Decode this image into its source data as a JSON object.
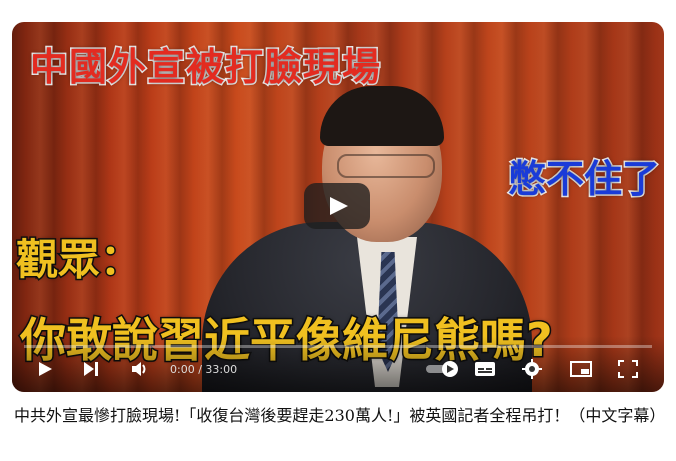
{
  "video": {
    "overlay": {
      "headline": "中國外宣被打臉現場",
      "cant_hold": "憋不住了",
      "audience": "觀眾：",
      "question": "你敢說習近平像維尼熊嗎?"
    },
    "time": "0:00 / 33:00"
  },
  "title": "中共外宣最慘打臉現場!「收復台灣後要趕走230萬人!」被英國記者全程吊打！（中文字幕）",
  "icons": {
    "play": "play-icon",
    "next": "next-icon",
    "volume": "volume-icon",
    "autoplay": "autoplay-toggle-icon",
    "subtitles": "subtitles-icon",
    "settings": "gear-icon",
    "miniplayer": "miniplayer-icon",
    "fullscreen": "fullscreen-icon"
  }
}
